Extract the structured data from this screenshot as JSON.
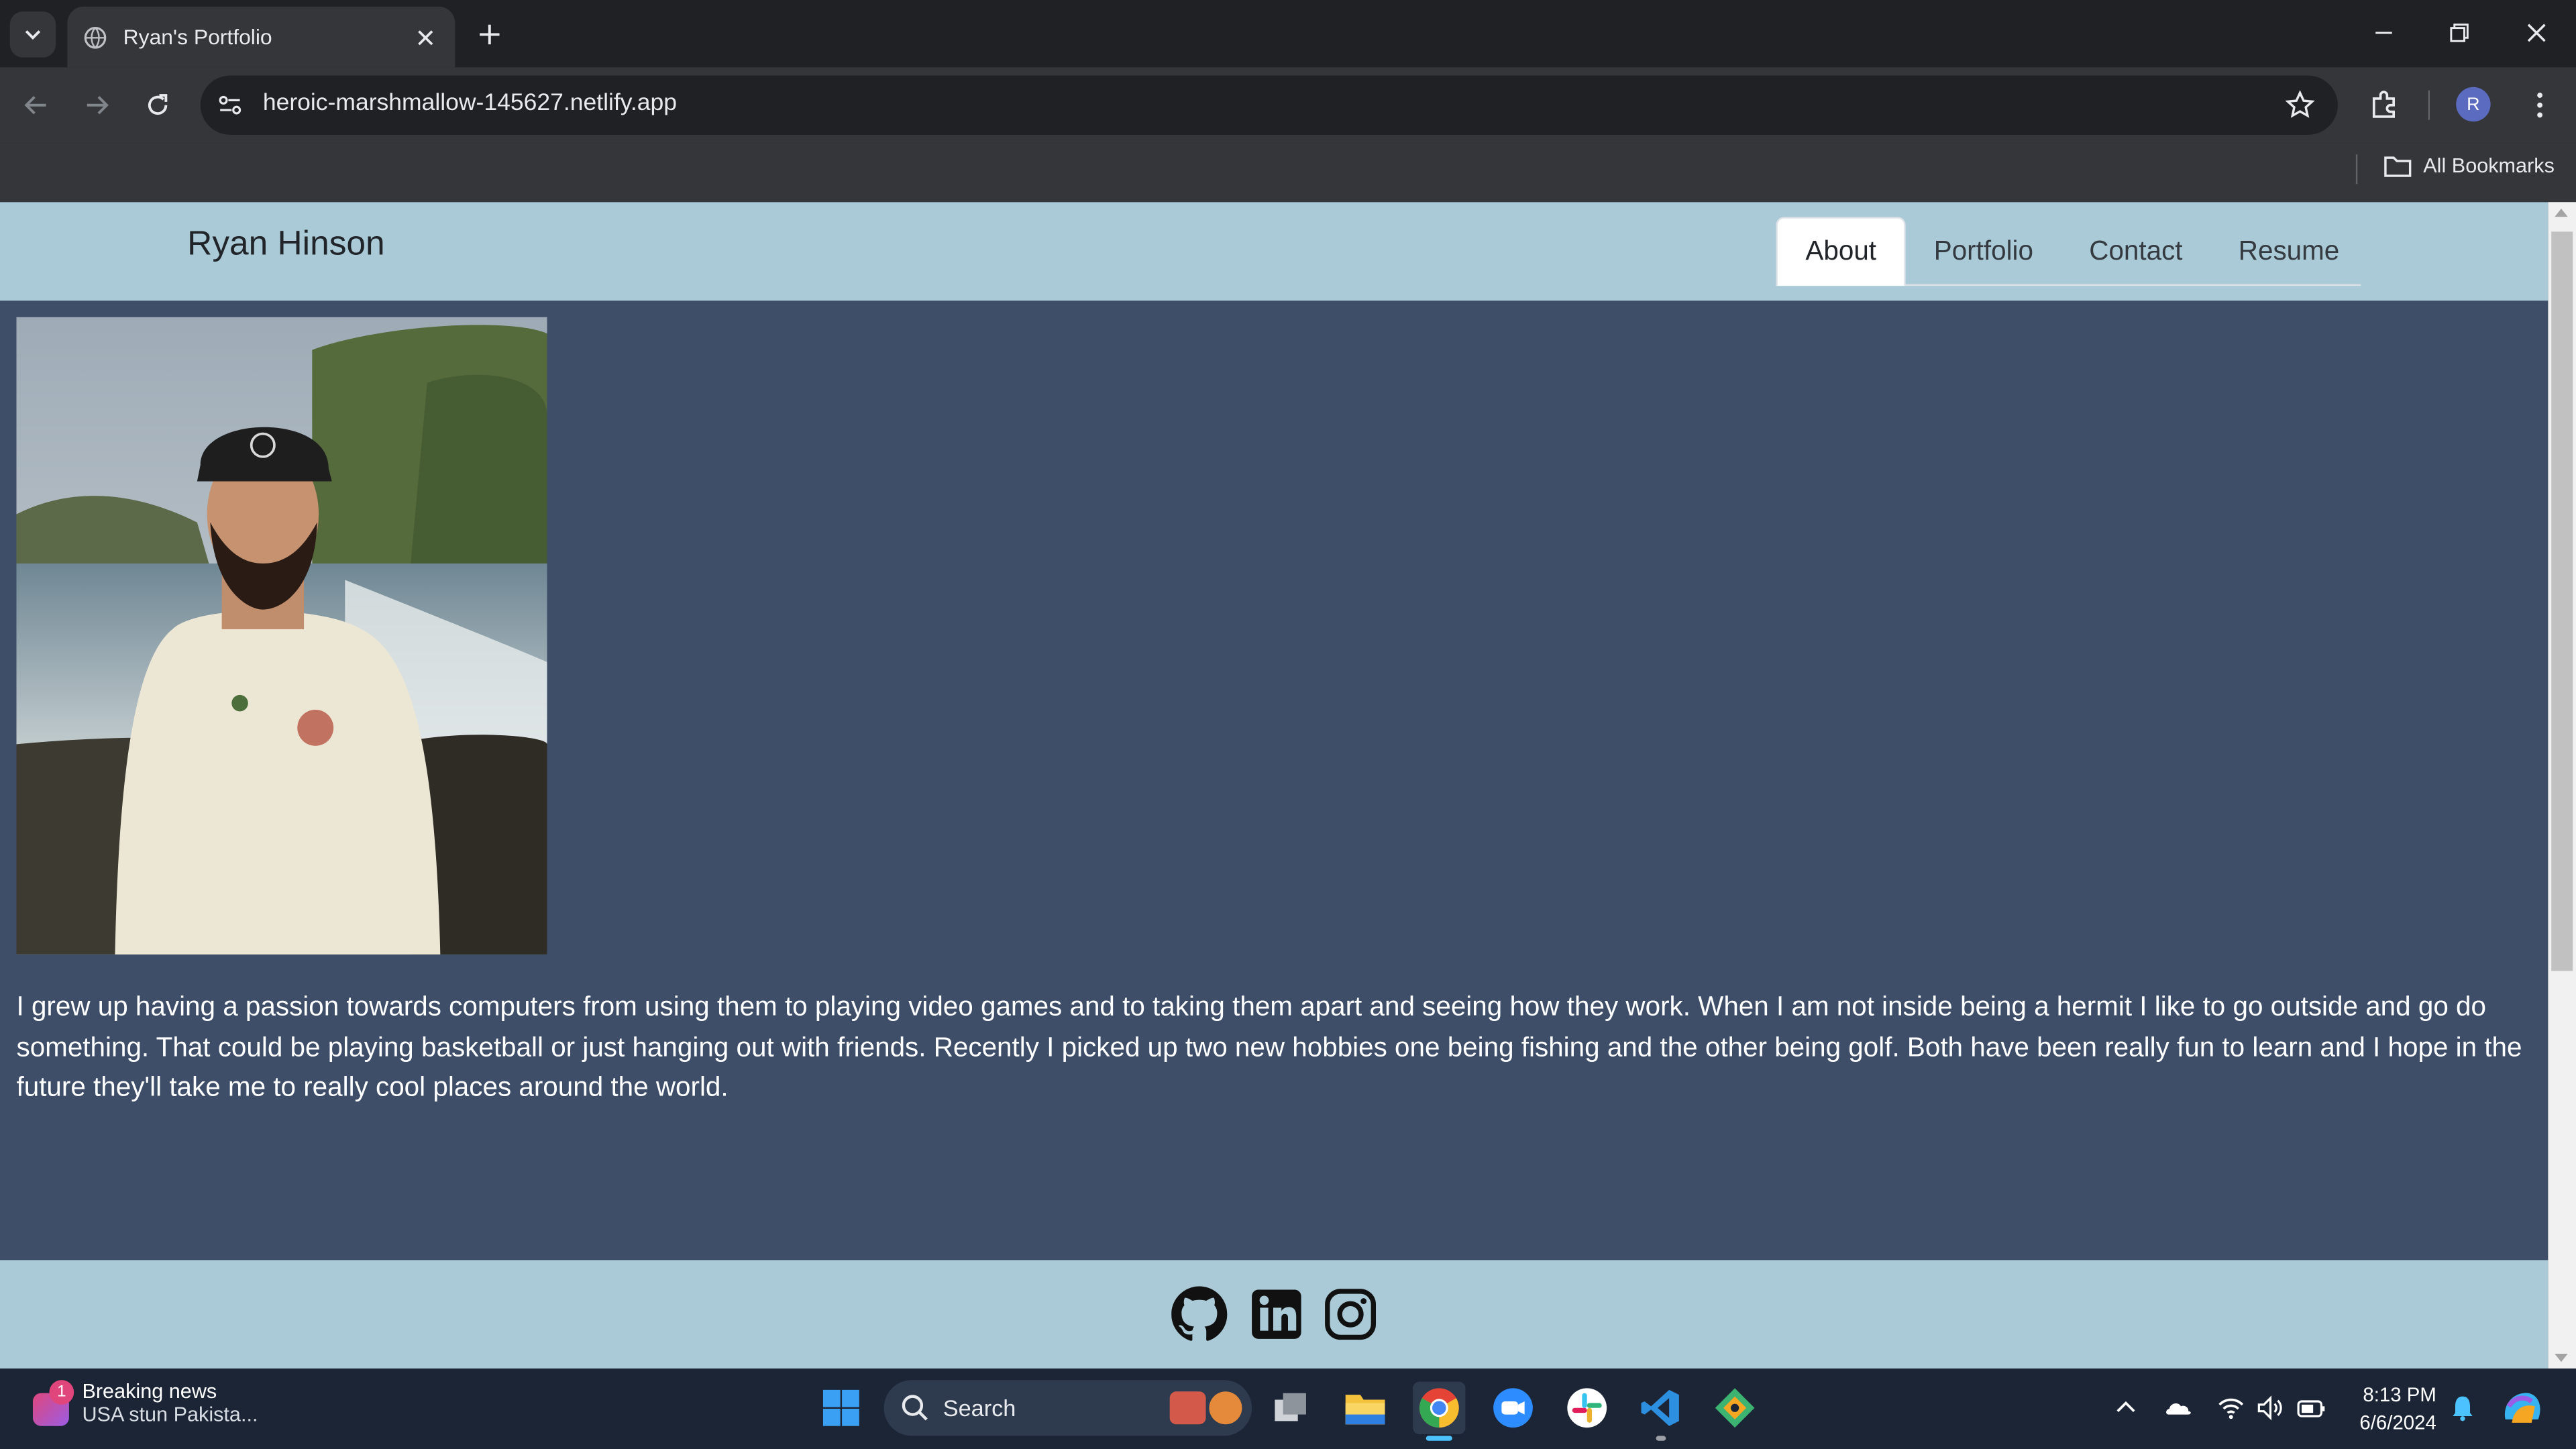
{
  "browser": {
    "tab_title": "Ryan's Portfolio",
    "url": "heroic-marshmallow-145627.netlify.app",
    "bookmarks_label": "All Bookmarks",
    "profile_initial": "R"
  },
  "site": {
    "brand": "Ryan Hinson",
    "nav": [
      {
        "label": "About",
        "active": true
      },
      {
        "label": "Portfolio",
        "active": false
      },
      {
        "label": "Contact",
        "active": false
      },
      {
        "label": "Resume",
        "active": false
      }
    ],
    "bio": "I grew up having a passion towards computers from using them to playing video games and to taking them apart and seeing how they work. When I am not inside being a hermit I like to go outside and go do something. That could be playing basketball or just hanging out with friends. Recently I picked up two new hobbies one being fishing and the other being golf. Both have been really fun to learn and I hope in the future they'll take me to really cool places around the world.",
    "social_icons": [
      "github-icon",
      "linkedin-icon",
      "instagram-icon"
    ],
    "colors": {
      "header": "#a9cad6",
      "body": "#3e4e69"
    }
  },
  "taskbar": {
    "news_badge": "1",
    "news_title": "Breaking news",
    "news_subtitle": "USA stun Pakista...",
    "search_label": "Search",
    "time": "8:13 PM",
    "date": "6/6/2024"
  }
}
